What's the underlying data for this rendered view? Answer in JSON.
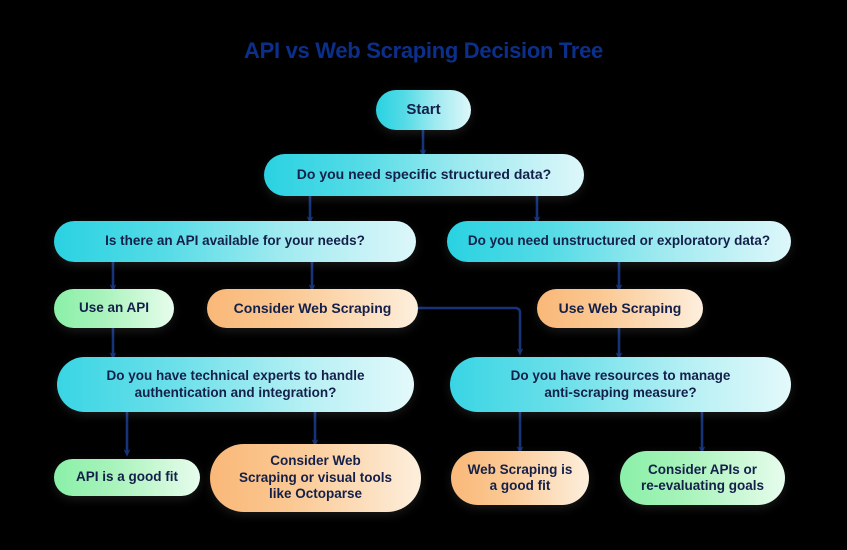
{
  "title": "API vs Web Scraping Decision Tree",
  "colors": {
    "background": "#000000",
    "title_text": "#0b2f8a",
    "node_text": "#14204a",
    "connector": "#16337a",
    "cyan_start": "#2ad2e2",
    "cyan_end": "#ddf7fa",
    "green_start": "#8af0a8",
    "green_end": "#e7fced",
    "orange_start": "#f9b878",
    "orange_end": "#fdefdd"
  },
  "chart_data": {
    "type": "diagram",
    "subtype": "decision-tree-flowchart",
    "title": "API vs Web Scraping Decision Tree",
    "nodes": [
      {
        "id": "start",
        "label": "Start",
        "color": "cyan",
        "level": 0
      },
      {
        "id": "q-structured",
        "label": "Do you need specific structured data?",
        "color": "cyan",
        "level": 1
      },
      {
        "id": "q-api-available",
        "label": "Is there an API available for your needs?",
        "color": "cyan",
        "level": 2
      },
      {
        "id": "q-unstructured",
        "label": "Do you need unstructured or exploratory data?",
        "color": "cyan",
        "level": 2
      },
      {
        "id": "use-api",
        "label": "Use an API",
        "color": "green",
        "level": 3
      },
      {
        "id": "consider-scraping",
        "label": "Consider Web Scraping",
        "color": "orange",
        "level": 3
      },
      {
        "id": "use-scraping",
        "label": "Use Web Scraping",
        "color": "orange",
        "level": 3
      },
      {
        "id": "q-tech-experts",
        "label": "Do you have technical experts to handle authentication and integration?",
        "color": "cyan",
        "level": 4
      },
      {
        "id": "q-resources",
        "label": "Do you have resources to manage anti-scraping measure?",
        "color": "cyan",
        "level": 4
      },
      {
        "id": "api-good-fit",
        "label": "API is a good fit",
        "color": "green",
        "level": 5
      },
      {
        "id": "consider-octoparse",
        "label": "Consider Web Scraping or visual tools like Octoparse",
        "color": "orange",
        "level": 5
      },
      {
        "id": "scraping-good-fit",
        "label": "Web Scraping is a good fit",
        "color": "orange",
        "level": 5
      },
      {
        "id": "consider-apis-reeval",
        "label": "Consider APIs or re-evaluating goals",
        "color": "green",
        "level": 5
      }
    ],
    "edges": [
      {
        "from": "start",
        "to": "q-structured"
      },
      {
        "from": "q-structured",
        "to": "q-api-available"
      },
      {
        "from": "q-structured",
        "to": "q-unstructured"
      },
      {
        "from": "q-api-available",
        "to": "use-api"
      },
      {
        "from": "q-api-available",
        "to": "consider-scraping"
      },
      {
        "from": "q-unstructured",
        "to": "use-scraping"
      },
      {
        "from": "use-api",
        "to": "q-tech-experts"
      },
      {
        "from": "consider-scraping",
        "to": "q-resources",
        "routing": "elbow-right"
      },
      {
        "from": "use-scraping",
        "to": "q-resources"
      },
      {
        "from": "q-tech-experts",
        "to": "api-good-fit"
      },
      {
        "from": "q-tech-experts",
        "to": "consider-octoparse"
      },
      {
        "from": "q-resources",
        "to": "scraping-good-fit"
      },
      {
        "from": "q-resources",
        "to": "consider-apis-reeval"
      }
    ]
  },
  "nodes": {
    "start": "Start",
    "q_structured": "Do you need specific structured data?",
    "q_api_available": "Is there an API available for your needs?",
    "q_unstructured": "Do you need unstructured or exploratory data?",
    "use_api": "Use an API",
    "consider_scraping": "Consider Web Scraping",
    "use_scraping": "Use Web Scraping",
    "q_tech_experts_l1": "Do you have technical experts to handle",
    "q_tech_experts_l2": "authentication and integration?",
    "q_resources_l1": "Do you have resources to manage",
    "q_resources_l2": "anti-scraping measure?",
    "api_good_fit": "API is a good fit",
    "consider_octoparse_l1": "Consider Web",
    "consider_octoparse_l2": "Scraping or visual tools",
    "consider_octoparse_l3": "like Octoparse",
    "scraping_good_fit_l1": "Web Scraping is",
    "scraping_good_fit_l2": "a good fit",
    "consider_apis_l1": "Consider APIs or",
    "consider_apis_l2": "re-evaluating goals"
  }
}
